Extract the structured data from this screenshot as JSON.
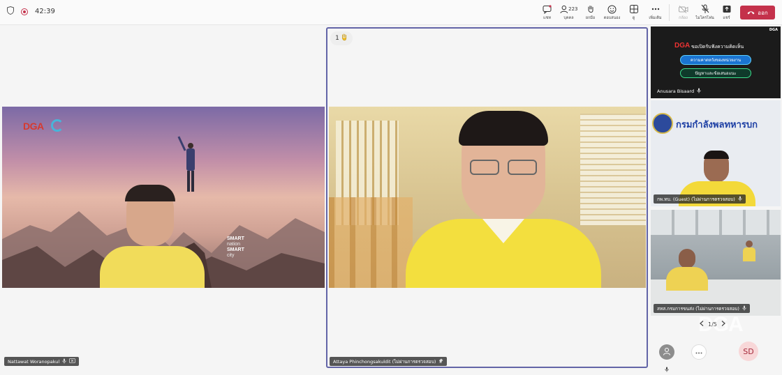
{
  "topbar": {
    "timer": "42:39",
    "buttons": [
      {
        "id": "chat",
        "label": "แชท",
        "icon": "chat-icon"
      },
      {
        "id": "people",
        "label": "บุคคล",
        "icon": "people-icon",
        "count": "223"
      },
      {
        "id": "raise",
        "label": "ยกมือ",
        "icon": "raise-hand-icon"
      },
      {
        "id": "react",
        "label": "ตอบสนอง",
        "icon": "reaction-icon"
      },
      {
        "id": "view",
        "label": "ดู",
        "icon": "view-icon"
      },
      {
        "id": "more",
        "label": "เพิ่มเติม",
        "icon": "more-icon"
      },
      {
        "id": "camera",
        "label": "กล้อง",
        "icon": "camera-off-icon"
      },
      {
        "id": "mic",
        "label": "ไมโครโฟน",
        "icon": "mic-off-icon"
      },
      {
        "id": "share",
        "label": "แชร์",
        "icon": "share-icon"
      }
    ],
    "leave_label": "ออก"
  },
  "stage": {
    "left_tile": {
      "name": "Nattawat Woranopakul",
      "logo_text": "DGA",
      "slide_lines": [
        "SMART",
        "nation",
        "SMART",
        "city"
      ]
    },
    "center_tile": {
      "name": "Attaya Phinchongsakuldit (ไม่ผ่านการตรวจสอบ)",
      "raise_count": "1"
    },
    "side_tiles": [
      {
        "name": "Anusara Bisaard",
        "logo_text": "DGA",
        "headline": "ขอเปิดรับฟังความคิดเห็น",
        "pill1": "ความคาดหวังของหน่วยงาน",
        "pill2": "ปัญหาและข้อเสนอแนะ",
        "corner_logo": "DGA"
      },
      {
        "name": "กพ.ทบ. (Guest) (ไม่ผ่านการตรวจสอบ)",
        "banner": "กรมกำลังพลทหารบก"
      },
      {
        "name": "สทส.กรมการขนส่ง (ไม่ผ่านการตรวจสอบ)"
      }
    ],
    "pager": "1/5",
    "watermark": "DGA",
    "self_avatar_initials": "SD"
  },
  "colors": {
    "accent": "#6264a7",
    "leave": "#c4314b",
    "recording": "#c4314b"
  }
}
